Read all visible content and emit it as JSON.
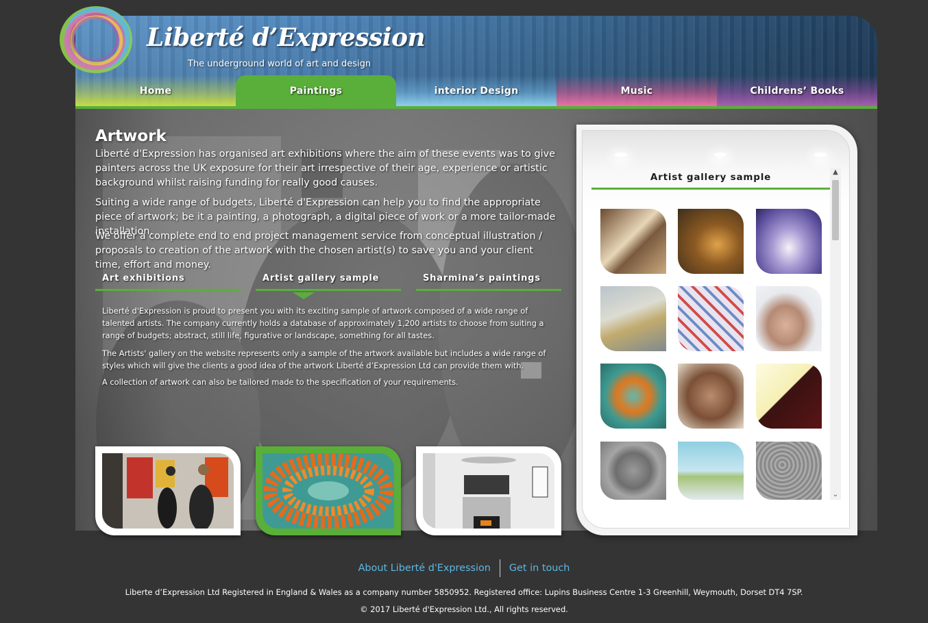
{
  "brand": {
    "title": "Liberté d’Expression",
    "tagline": "The underground world of art and design"
  },
  "nav": {
    "items": [
      {
        "label": "Home"
      },
      {
        "label": "Paintings"
      },
      {
        "label": "interior  Design"
      },
      {
        "label": "Music"
      },
      {
        "label": "Childrens’  Books"
      }
    ],
    "active": "Paintings"
  },
  "content": {
    "title": "Artwork",
    "paragraphs": [
      "Liberté d'Expression has organised art exhibitions where the aim of these events was to give painters across the UK exposure for their art irrespective of their age, experience or artistic background whilst raising funding for really good causes.",
      "Suiting a wide range of budgets, Liberté d'Expression can help you to find the appropriate piece of artwork; be it a painting, a photograph, a digital piece of work or a more tailor-made installation.",
      "We offer a complete end to end project management service from conceptual illustration / proposals to creation of the artwork with the chosen artist(s) to save you and your client time, effort and money."
    ],
    "tabs": [
      {
        "label": "Art  exhibitions"
      },
      {
        "label": "Artist  gallery  sample"
      },
      {
        "label": "Sharmina’s  paintings"
      }
    ],
    "tab_paragraphs": [
      "Liberté d'Expression is proud to present you with its exciting sample of artwork composed of a wide range of talented artists. The company currently holds a database of approximately 1,200 artists to choose from suiting a range of budgets; abstract, still life, figurative or landscape, something for all tastes.",
      "The Artists' gallery on the website represents only a sample of the artwork available but includes a wide range of styles which will give the clients a good idea of the artwork Liberté d’Expression Ltd can provide them with.",
      "A collection of artwork can also be tailored made to the specification of your requirements."
    ]
  },
  "gallery": {
    "heading": "Artist  gallery  sample"
  },
  "footer": {
    "links": [
      "About Liberté d'Expression",
      "Get in touch"
    ],
    "registration": "Liberte d’Expression Ltd Registered in England & Wales as a company number 5850952. Registered office: Lupins Business Centre 1-3 Greenhill, Weymouth, Dorset DT4 7SP.",
    "copyright": "© 2017 Liberté d'Expression Ltd., All rights reserved."
  },
  "colors": {
    "accent_green": "#5aaf3a",
    "link_blue": "#5bb8e5",
    "page_bg": "#343434"
  },
  "icons": {
    "scroll_up": "chevron-up-icon",
    "scroll_down": "chevron-down-icon"
  }
}
